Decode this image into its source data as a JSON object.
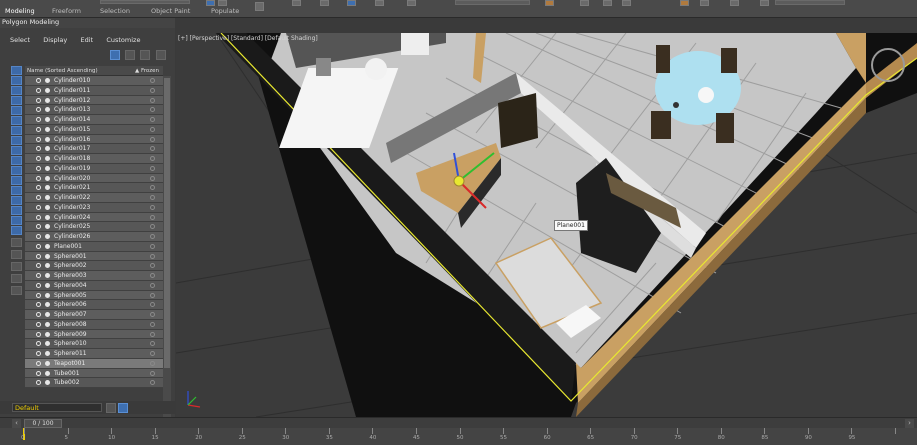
{
  "ribbon": {
    "tabs": [
      "Modeling",
      "Freeform",
      "Selection",
      "Object Paint",
      "Populate"
    ],
    "active_tab": "Modeling",
    "subtitle": "Polygon Modeling"
  },
  "explorer": {
    "menu": [
      "Select",
      "Display",
      "Edit",
      "Customize"
    ],
    "col_name": "Name (Sorted Ascending)",
    "col_frozen": "▲ Frozen",
    "items": [
      "Cylinder010",
      "Cylinder011",
      "Cylinder012",
      "Cylinder013",
      "Cylinder014",
      "Cylinder015",
      "Cylinder016",
      "Cylinder017",
      "Cylinder018",
      "Cylinder019",
      "Cylinder020",
      "Cylinder021",
      "Cylinder022",
      "Cylinder023",
      "Cylinder024",
      "Cylinder025",
      "Cylinder026",
      "Plane001",
      "Sphere001",
      "Sphere002",
      "Sphere003",
      "Sphere004",
      "Sphere005",
      "Sphere006",
      "Sphere007",
      "Sphere008",
      "Sphere009",
      "Sphere010",
      "Sphere011",
      "Teapot001",
      "Tube001",
      "Tube002"
    ],
    "selected_item": "Teapot001"
  },
  "layer": {
    "current": "Default",
    "color": "#f0d000"
  },
  "viewport": {
    "label": "[+] [Perspective] [Standard] [Default Shading]",
    "tooltip": "Plane001",
    "colors": {
      "wall_wood": "#c9a063",
      "floor": "#c3c3c3",
      "table_top": "#aee0f0",
      "selection": "#e8e830",
      "dark": "#111111"
    }
  },
  "timeline": {
    "slider": "0 / 100",
    "labels": [
      "0",
      "5",
      "10",
      "15",
      "20",
      "25",
      "30",
      "35",
      "40",
      "45",
      "50",
      "55",
      "60",
      "65",
      "70",
      "75",
      "80",
      "85",
      "90",
      "95"
    ]
  }
}
